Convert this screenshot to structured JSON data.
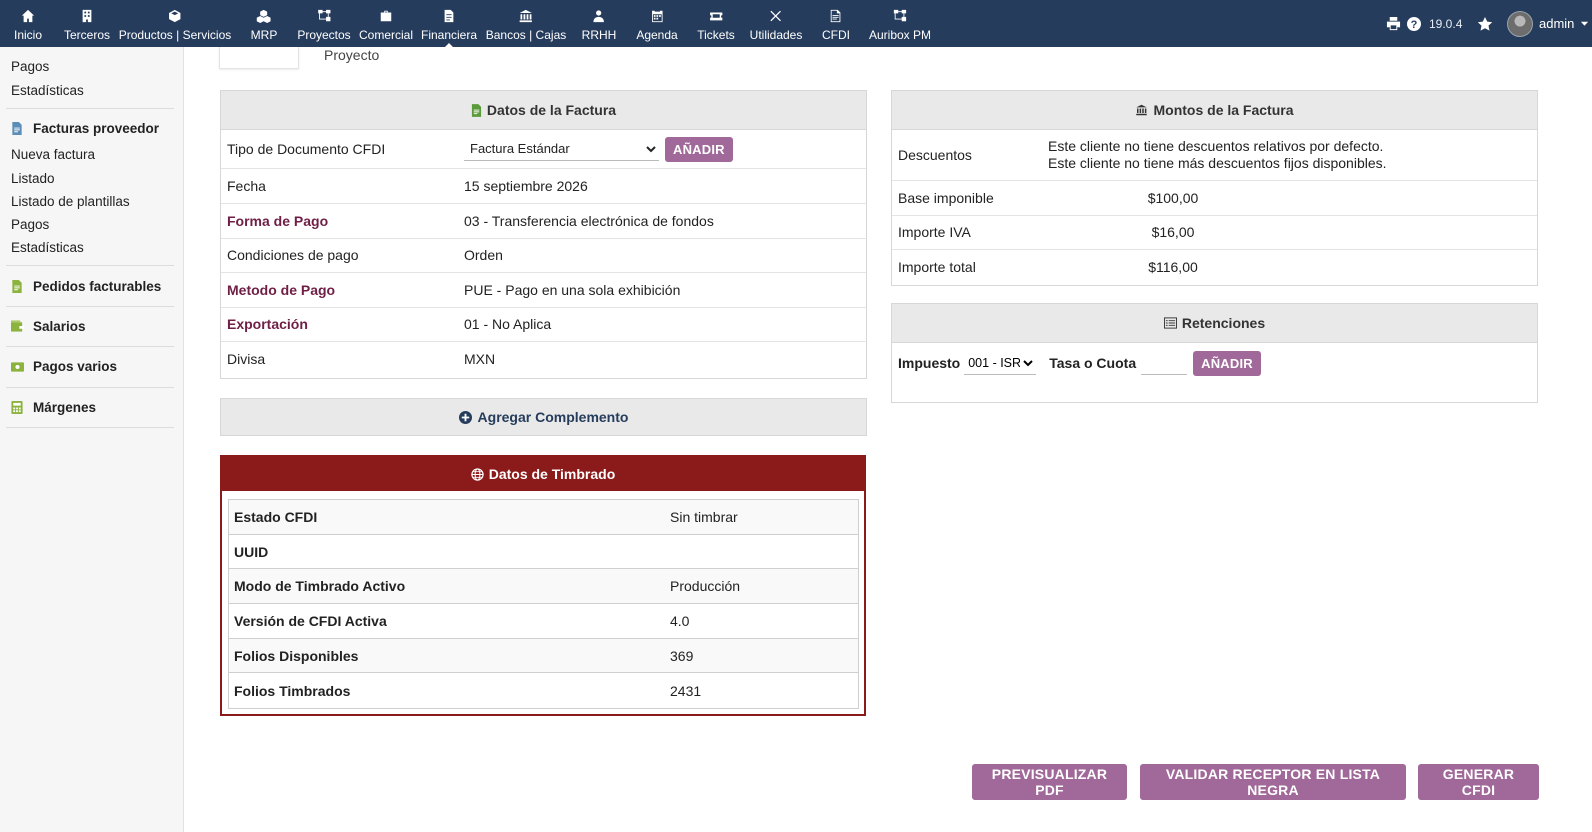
{
  "topbar": {
    "nav": [
      {
        "label": "Inicio",
        "icon": "home-icon",
        "active": false
      },
      {
        "label": "Terceros",
        "icon": "building-icon",
        "active": false
      },
      {
        "label": "Productos | Servicios",
        "icon": "cube-icon",
        "active": false
      },
      {
        "label": "MRP",
        "icon": "cubes-icon",
        "active": false
      },
      {
        "label": "Proyectos",
        "icon": "sitemap-icon",
        "active": false
      },
      {
        "label": "Comercial",
        "icon": "briefcase-icon",
        "active": false
      },
      {
        "label": "Financiera",
        "icon": "invoice-icon",
        "active": true
      },
      {
        "label": "Bancos | Cajas",
        "icon": "bank-icon",
        "active": false
      },
      {
        "label": "RRHH",
        "icon": "users-icon",
        "active": false
      },
      {
        "label": "Agenda",
        "icon": "calendar-icon",
        "active": false
      },
      {
        "label": "Tickets",
        "icon": "ticket-icon",
        "active": false
      },
      {
        "label": "Utilidades",
        "icon": "tools-icon",
        "active": false
      },
      {
        "label": "CFDI",
        "icon": "cfdi-icon",
        "active": false
      },
      {
        "label": "Auribox PM",
        "icon": "sitemap-icon",
        "active": false
      }
    ],
    "version": "19.0.4",
    "username": "admin"
  },
  "sidebar": {
    "top_items": [
      "Pagos",
      "Estadísticas"
    ],
    "facturas_proveedor": {
      "title": "Facturas proveedor",
      "items": [
        "Nueva factura",
        "Listado",
        "Listado de plantillas",
        "Pagos",
        "Estadísticas"
      ]
    },
    "sections": [
      "Pedidos facturables",
      "Salarios",
      "Pagos varios",
      "Márgenes"
    ]
  },
  "project_label": "Proyecto",
  "datos_factura": {
    "title": "Datos de la Factura",
    "tipo_label": "Tipo de Documento CFDI",
    "tipo_value": "Factura Estándar",
    "add_button": "AÑADIR",
    "rows": [
      {
        "label": "Fecha",
        "value": "15 septiembre 2026",
        "required": false
      },
      {
        "label": "Forma de Pago",
        "value": "03 - Transferencia electrónica de fondos",
        "required": true
      },
      {
        "label": "Condiciones de pago",
        "value": "Orden",
        "required": false
      },
      {
        "label": "Metodo de Pago",
        "value": "PUE - Pago en una sola exhibición",
        "required": true
      },
      {
        "label": "Exportación",
        "value": "01 - No Aplica",
        "required": true
      },
      {
        "label": "Divisa",
        "value": "MXN",
        "required": false
      }
    ]
  },
  "agregar_complemento": "Agregar Complemento",
  "timbrado": {
    "title": "Datos de Timbrado",
    "rows": [
      {
        "label": "Estado CFDI",
        "value": "Sin timbrar"
      },
      {
        "label": "UUID",
        "value": ""
      },
      {
        "label": "Modo de Timbrado Activo",
        "value": "Producción"
      },
      {
        "label": "Versión de CFDI Activa",
        "value": "4.0"
      },
      {
        "label": "Folios Disponibles",
        "value": "369"
      },
      {
        "label": "Folios Timbrados",
        "value": "2431"
      }
    ]
  },
  "montos": {
    "title": "Montos de la Factura",
    "descuentos_label": "Descuentos",
    "descuentos_line1": "Este cliente no tiene descuentos relativos por defecto.",
    "descuentos_line2": "Este cliente no tiene más descuentos fijos disponibles.",
    "rows": [
      {
        "label": "Base imponible",
        "value": "$100,00"
      },
      {
        "label": "Importe IVA",
        "value": "$16,00"
      },
      {
        "label": "Importe total",
        "value": "$116,00"
      }
    ]
  },
  "retenciones": {
    "title": "Retenciones",
    "impuesto_label": "Impuesto",
    "impuesto_value": "001 - ISR",
    "tasa_label": "Tasa o Cuota",
    "tasa_value": "",
    "add_button": "AÑADIR"
  },
  "actions": {
    "preview": "PREVISUALIZAR PDF",
    "validar": "VALIDAR RECEPTOR EN LISTA NEGRA",
    "generar": "GENERAR CFDI"
  },
  "colors": {
    "topbar": "#263c5c",
    "accent_button": "#a06999",
    "timbrado_red": "#8b1a1a",
    "required_label": "#6f1f45",
    "sidebar_icon": "#8bb33d"
  }
}
